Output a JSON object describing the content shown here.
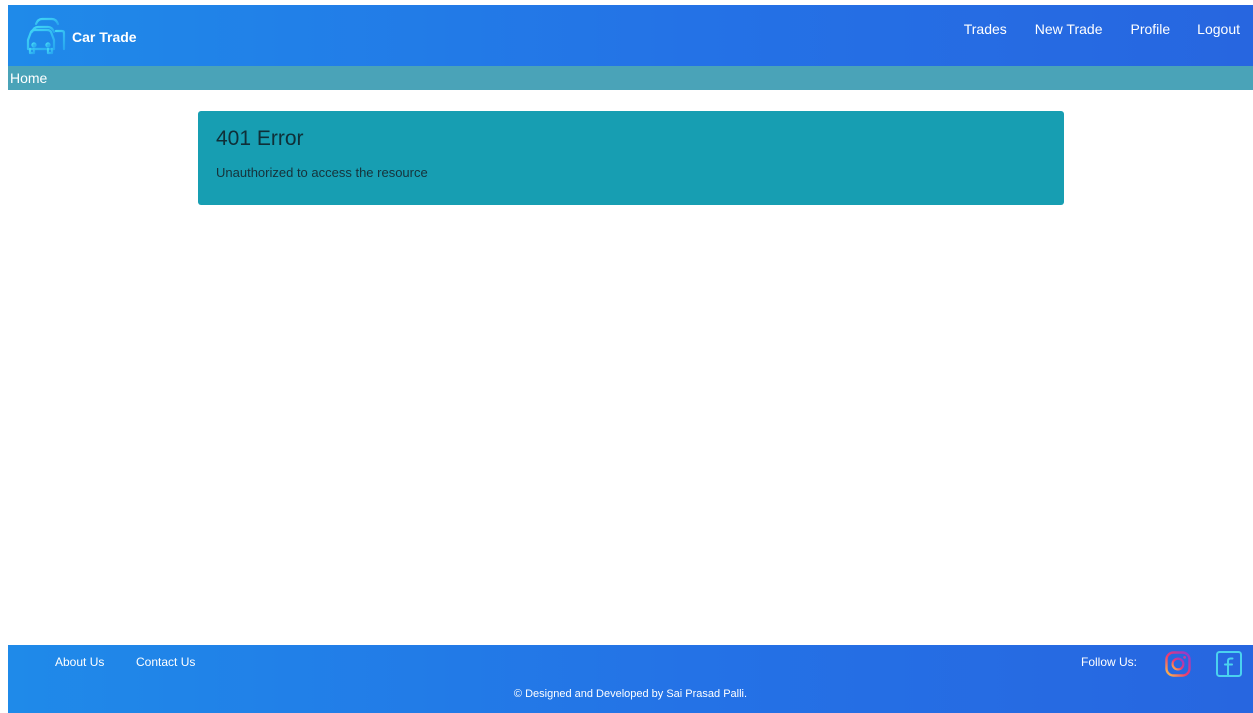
{
  "navbar": {
    "brand_label": "Car Trade",
    "links": [
      {
        "label": "Trades"
      },
      {
        "label": "New Trade"
      },
      {
        "label": "Profile"
      },
      {
        "label": "Logout"
      }
    ],
    "background": "#2472e6"
  },
  "breadcrumb": {
    "items": [
      "Home"
    ],
    "background": "#4aa3b8"
  },
  "alert": {
    "title": "401 Error",
    "message": "Unauthorized to access the resource",
    "background": "#179eb2"
  },
  "footer": {
    "links": [
      "About Us",
      "Contact Us"
    ],
    "follow_label": "Follow Us:",
    "social_icons": [
      "instagram-icon",
      "facebook-icon"
    ],
    "copyright": "© Designed and Developed by Sai Prasad Palli."
  }
}
